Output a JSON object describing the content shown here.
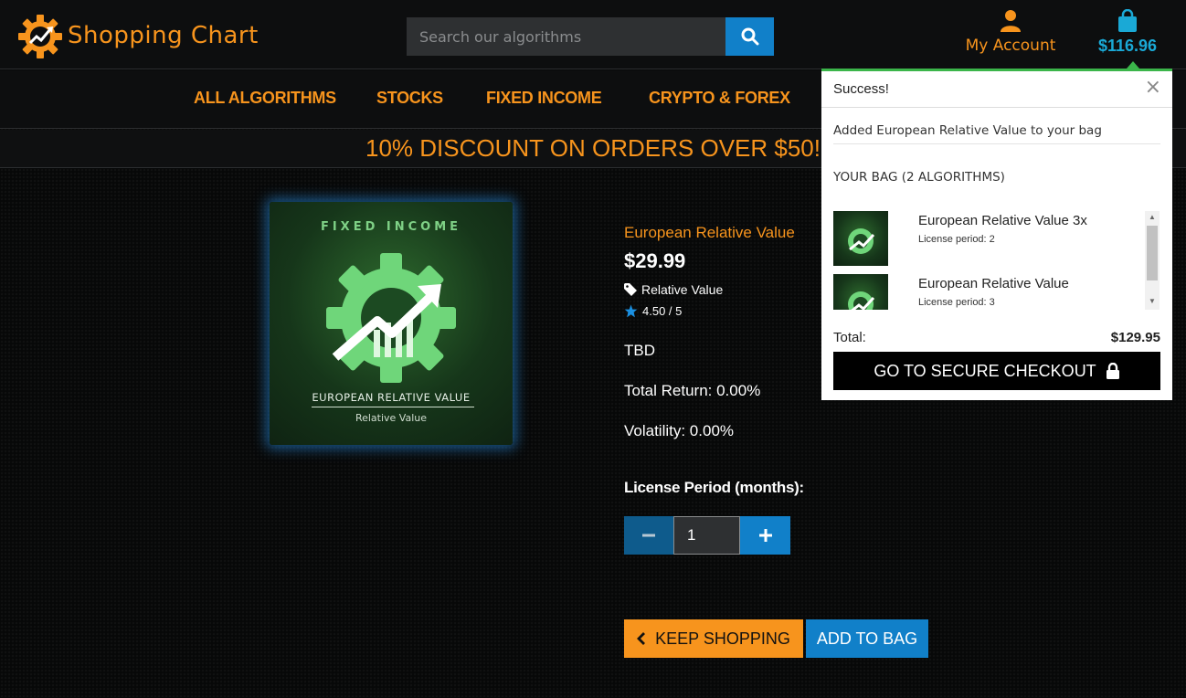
{
  "header": {
    "logo_text": "Shopping Chart",
    "search_placeholder": "Search our algorithms",
    "account_label": "My Account",
    "cart_total": "$116.96"
  },
  "nav": {
    "items": [
      "ALL ALGORITHMS",
      "STOCKS",
      "FIXED INCOME",
      "CRYPTO & FOREX"
    ]
  },
  "promo": "10% DISCOUNT ON ORDERS OVER $50!",
  "product": {
    "image": {
      "category": "FIXED INCOME",
      "name": "EUROPEAN RELATIVE VALUE",
      "subtitle": "Relative Value"
    },
    "name": "European Relative Value",
    "price": "$29.99",
    "tag": "Relative Value",
    "rating": "4.50 / 5",
    "description": "TBD",
    "total_return": "Total Return: 0.00%",
    "volatility": "Volatility: 0.00%",
    "license_label": "License Period (months):",
    "quantity": "1",
    "keep_shopping": "KEEP SHOPPING",
    "add_to_bag": "ADD TO BAG"
  },
  "popup": {
    "title": "Success!",
    "close": "×",
    "message": "Added European Relative Value to your bag",
    "bag_title": "YOUR BAG (2 ALGORITHMS)",
    "items": [
      {
        "name": "European Relative Value 3x",
        "license": "License period: 2"
      },
      {
        "name": "European Relative Value",
        "license": "License period: 3"
      }
    ],
    "total_label": "Total:",
    "total_value": "$129.95",
    "checkout": "GO TO SECURE CHECKOUT"
  },
  "colors": {
    "accent_orange": "#f7941d",
    "accent_blue": "#1180c9",
    "success_green": "#3bb54a"
  },
  "icons": [
    "logo-gear-icon",
    "search-icon",
    "user-icon",
    "shopping-bag-icon",
    "tag-icon",
    "star-icon",
    "minus-icon",
    "plus-icon",
    "chevron-left-icon",
    "lock-icon",
    "close-icon"
  ]
}
